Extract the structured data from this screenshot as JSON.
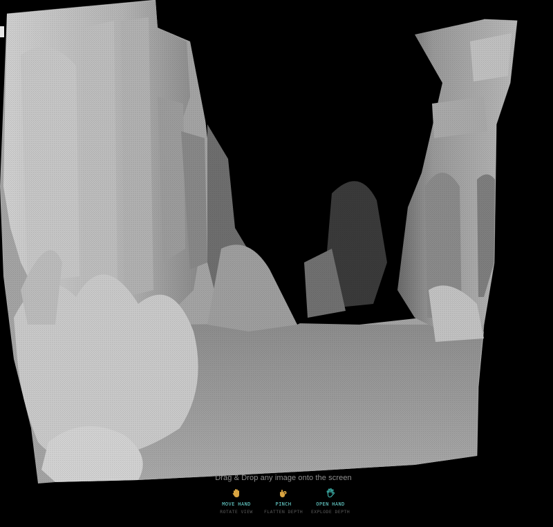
{
  "viewer": {
    "drop_hint": "Drag & Drop any image onto the screen"
  },
  "colors": {
    "background": "#000000",
    "hint_text": "#8f8f8f",
    "gesture_title": "#6fe0dc",
    "gesture_subtitle": "#5a5a5a",
    "icon_gold": "#d9a441",
    "icon_teal": "#3fb8b0"
  },
  "gestures": [
    {
      "icon": "move-hand-icon",
      "title": "MOVE HAND",
      "subtitle": "ROTATE VIEW"
    },
    {
      "icon": "pinch-hand-icon",
      "title": "PINCH",
      "subtitle": "FLATTEN DEPTH"
    },
    {
      "icon": "open-hand-icon",
      "title": "OPEN HAND",
      "subtitle": "EXPLODE DEPTH"
    }
  ]
}
